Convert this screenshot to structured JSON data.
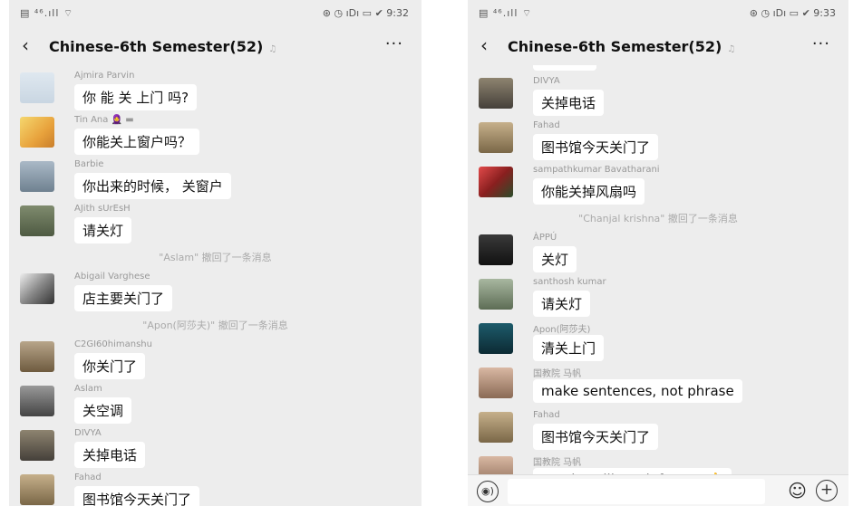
{
  "left": {
    "status": {
      "left": "▤ ⁴⁶.ıll ⌔",
      "right": "⊛ ◷ ıDı ▭ ✔ 9:32"
    },
    "title": "Chinese-6th Semester(52)",
    "items": [
      {
        "kind": "msg",
        "sender": "Ajmira Parvin",
        "text": "你 能 关 上门 吗?",
        "avatar": "av1"
      },
      {
        "kind": "msg",
        "sender": "Tin Ana 🧕 ▬",
        "text": "你能关上窗户吗？",
        "avatar": "av2"
      },
      {
        "kind": "msg",
        "sender": "Barbie",
        "text": "你出来的时候， 关窗户",
        "avatar": "av3"
      },
      {
        "kind": "msg",
        "sender": "AJith sUrEsH",
        "text": "请关灯",
        "avatar": "av4"
      },
      {
        "kind": "system",
        "text": "\"Aslam\" 撤回了一条消息"
      },
      {
        "kind": "msg",
        "sender": "Abigail Varghese",
        "text": "店主要关门了",
        "avatar": "av5"
      },
      {
        "kind": "system",
        "text": "\"Apon(阿莎夫)\" 撤回了一条消息"
      },
      {
        "kind": "msg",
        "sender": "C2GI60himanshu",
        "text": "你关门了",
        "avatar": "av6"
      },
      {
        "kind": "msg",
        "sender": "Aslam",
        "text": "关空调",
        "avatar": "av7"
      },
      {
        "kind": "msg",
        "sender": "DIVYA",
        "text": "关掉电话",
        "avatar": "av8"
      },
      {
        "kind": "msg",
        "sender": "Fahad",
        "text": "图书馆今天关门了",
        "avatar": "av9"
      }
    ]
  },
  "right": {
    "status": {
      "left": "▤ ⁴⁶.ıll ⌔",
      "right": "⊛ ◷ ıDı ▭ ✔ 9:33"
    },
    "title": "Chinese-6th Semester(52)",
    "items": [
      {
        "kind": "msg",
        "sender": "DIVYA",
        "text": "关掉电话",
        "avatar": "av8"
      },
      {
        "kind": "msg",
        "sender": "Fahad",
        "text": "图书馆今天关门了",
        "avatar": "av9"
      },
      {
        "kind": "msg",
        "sender": "sampathkumar Bavatharani",
        "text": "你能关掉风扇吗",
        "avatar": "av10"
      },
      {
        "kind": "system",
        "text": "\"Chanjal krishna\" 撤回了一条消息"
      },
      {
        "kind": "msg",
        "sender": "ÀPPÚ",
        "text": "关灯",
        "avatar": "av11"
      },
      {
        "kind": "msg",
        "sender": "santhosh kumar",
        "text": "请关灯",
        "avatar": "av12"
      },
      {
        "kind": "msg",
        "sender": "Apon(阿莎夫)",
        "text": "清关上门",
        "avatar": "av13"
      },
      {
        "kind": "msg",
        "sender": "国教院 马帆",
        "text": "make sentences, not phrase",
        "avatar": "av14"
      },
      {
        "kind": "msg",
        "sender": "Fahad",
        "text": "图书馆今天关门了",
        "avatar": "av9"
      },
      {
        "kind": "msg",
        "sender": "国教院 马帆",
        "text": "good, I will mark for you👍",
        "avatar": "av14"
      }
    ]
  },
  "icons": {
    "back": "‹",
    "more": "···",
    "mute": "♫",
    "voice": "◉)",
    "emoji": "☺",
    "plus": "+"
  }
}
